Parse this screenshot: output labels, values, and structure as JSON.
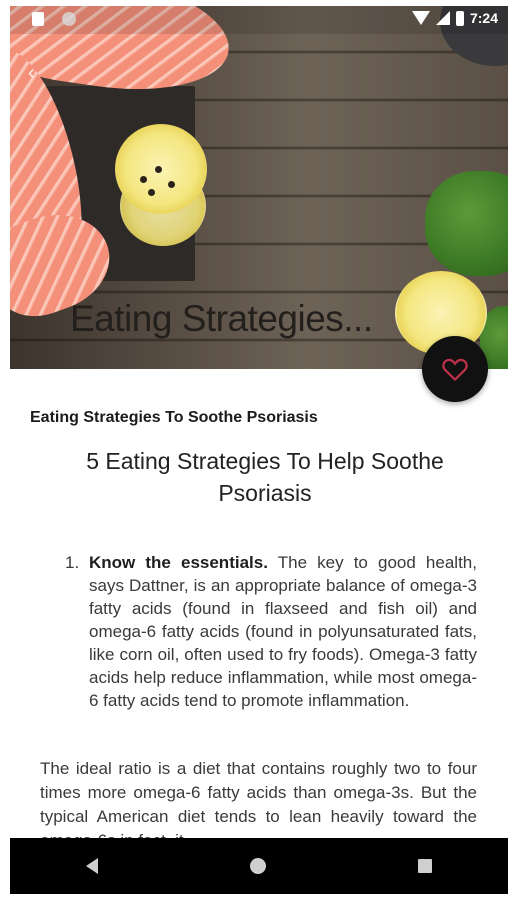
{
  "status_bar": {
    "time": "7:24",
    "icons": [
      "sim-icon",
      "notification-icon",
      "wifi-icon",
      "signal-icon",
      "battery-icon"
    ]
  },
  "hero": {
    "title": "Eating Strategies...",
    "favorite_icon": "heart-outline-icon",
    "accent_color": "#c0304a"
  },
  "article": {
    "title": "Eating Strategies To Soothe Psoriasis",
    "headline": "5 Eating Strategies To Help Soothe Psoriasis",
    "list": [
      {
        "number": "1.",
        "bold": "Know the essentials.",
        "text": " The key to good health, says Dattner, is an appropriate balance of omega-3 fatty acids (found in flaxseed and fish oil) and omega-6 fatty acids (found in polyunsaturated fats, like corn oil, often used to fry foods). Omega-3 fatty acids help reduce inflammation, while most omega-6 fatty acids tend to promote inflammation."
      }
    ],
    "paragraph": "The ideal ratio is a diet that contains roughly two to four times more omega-6 fatty acids than omega-3s. But the typical American diet tends to lean heavily toward the omega-6s in fact, it"
  },
  "nav_bar": {
    "icons": [
      "back-icon",
      "home-icon",
      "recents-icon"
    ]
  }
}
